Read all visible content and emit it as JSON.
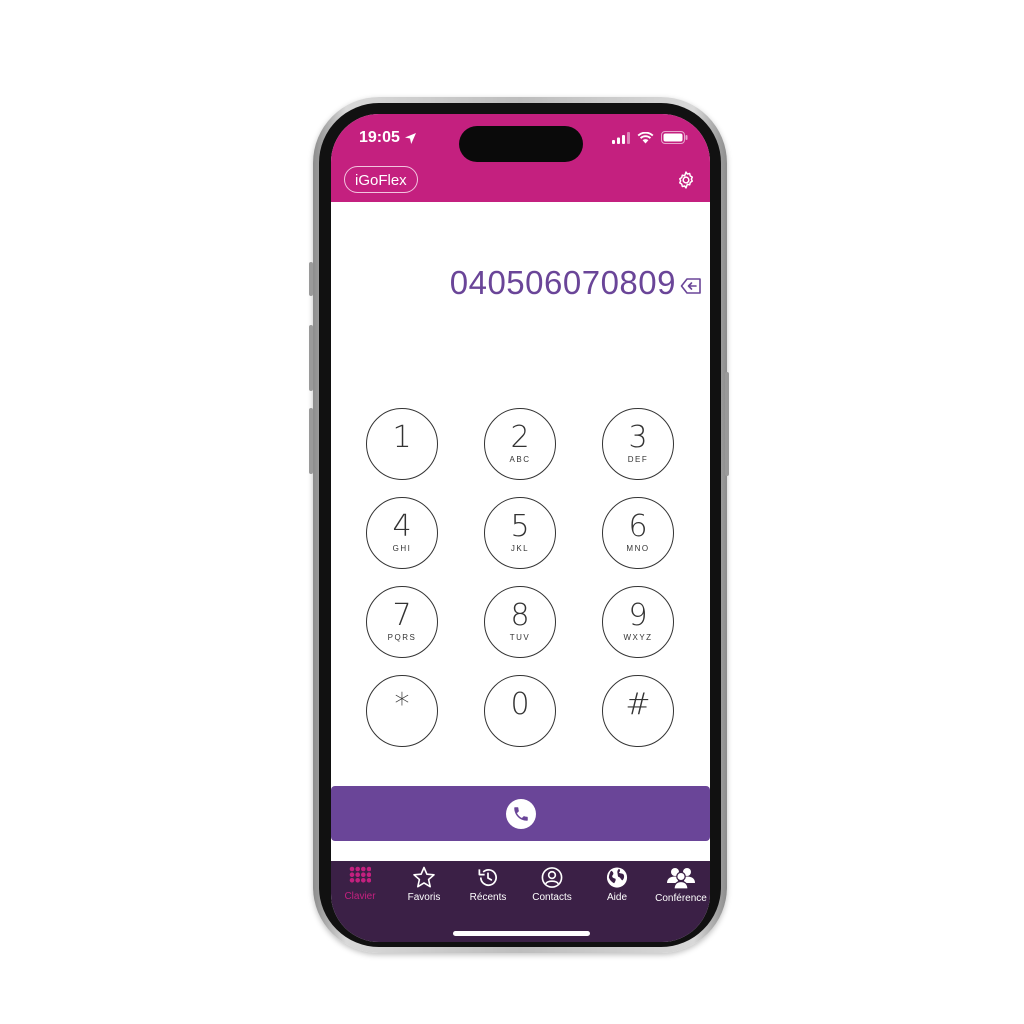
{
  "status": {
    "time": "19:05"
  },
  "header": {
    "brand": "iGoFlex"
  },
  "dialer": {
    "number": "040506070809",
    "keys": [
      {
        "digit": "1",
        "letters": ""
      },
      {
        "digit": "2",
        "letters": "ABC"
      },
      {
        "digit": "3",
        "letters": "DEF"
      },
      {
        "digit": "4",
        "letters": "GHI"
      },
      {
        "digit": "5",
        "letters": "JKL"
      },
      {
        "digit": "6",
        "letters": "MNO"
      },
      {
        "digit": "7",
        "letters": "PQRS"
      },
      {
        "digit": "8",
        "letters": "TUV"
      },
      {
        "digit": "9",
        "letters": "WXYZ"
      },
      {
        "digit": "*",
        "letters": ""
      },
      {
        "digit": "0",
        "letters": ""
      },
      {
        "digit": "#",
        "letters": ""
      }
    ]
  },
  "tabs": [
    {
      "label": "Clavier",
      "icon": "keypad-icon",
      "active": true
    },
    {
      "label": "Favoris",
      "icon": "star-icon"
    },
    {
      "label": "Récents",
      "icon": "history-icon"
    },
    {
      "label": "Contacts",
      "icon": "contact-icon"
    },
    {
      "label": "Aide",
      "icon": "globe-icon"
    },
    {
      "label": "Conférence",
      "icon": "group-icon"
    }
  ],
  "colors": {
    "header": "#c4207f",
    "accent": "#6a4598",
    "tabbar": "#3b2046",
    "active_tab": "#c4207f"
  }
}
